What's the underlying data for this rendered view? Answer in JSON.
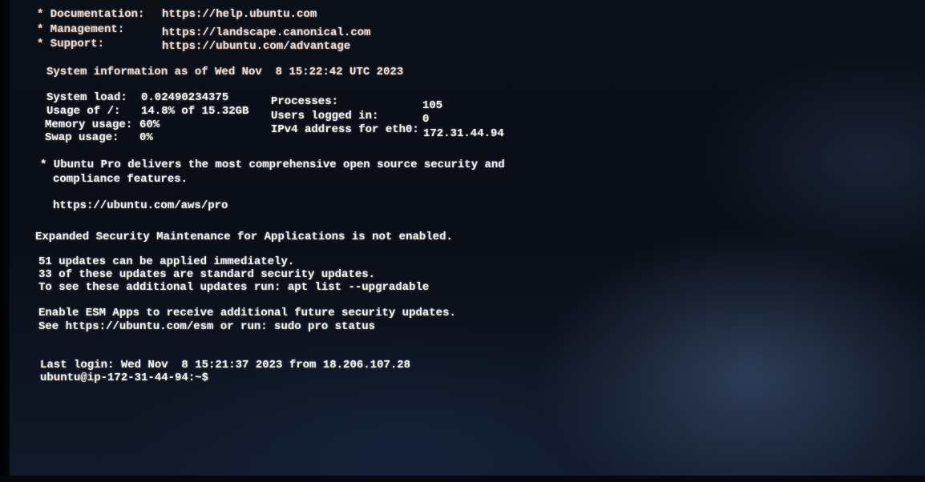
{
  "motd": {
    "links": [
      {
        "label": "* Documentation:",
        "url": "https://help.ubuntu.com"
      },
      {
        "label": "* Management:",
        "url": "https://landscape.canonical.com"
      },
      {
        "label": "* Support:",
        "url": "https://ubuntu.com/advantage"
      }
    ],
    "sysinfo_header": "System information as of Wed Nov  8 15:22:42 UTC 2023",
    "stats_left": [
      {
        "label": "System load:",
        "value": "0.02490234375"
      },
      {
        "label": "Usage of /:",
        "value": "14.8% of 15.32GB"
      },
      {
        "label": "Memory usage:",
        "value": "60%"
      },
      {
        "label": "Swap usage:",
        "value": "0%"
      }
    ],
    "stats_right": [
      {
        "label": "Processes:",
        "value": "105"
      },
      {
        "label": "Users logged in:",
        "value": "0"
      },
      {
        "label": "IPv4 address for eth0:",
        "value": "172.31.44.94"
      }
    ],
    "pro_notice_1": "* Ubuntu Pro delivers the most comprehensive open source security and",
    "pro_notice_2": "compliance features.",
    "pro_url": "https://ubuntu.com/aws/pro",
    "esm_notice": "Expanded Security Maintenance for Applications is not enabled.",
    "updates_1": "51 updates can be applied immediately.",
    "updates_2": "33 of these updates are standard security updates.",
    "updates_3": "To see these additional updates run: apt list --upgradable",
    "esm_apps_1": "Enable ESM Apps to receive additional future security updates.",
    "esm_apps_2": "See https://ubuntu.com/esm or run: sudo pro status",
    "last_login": "Last login: Wed Nov  8 15:21:37 2023 from 18.206.107.28",
    "prompt": "ubuntu@ip-172-31-44-94:~$"
  }
}
